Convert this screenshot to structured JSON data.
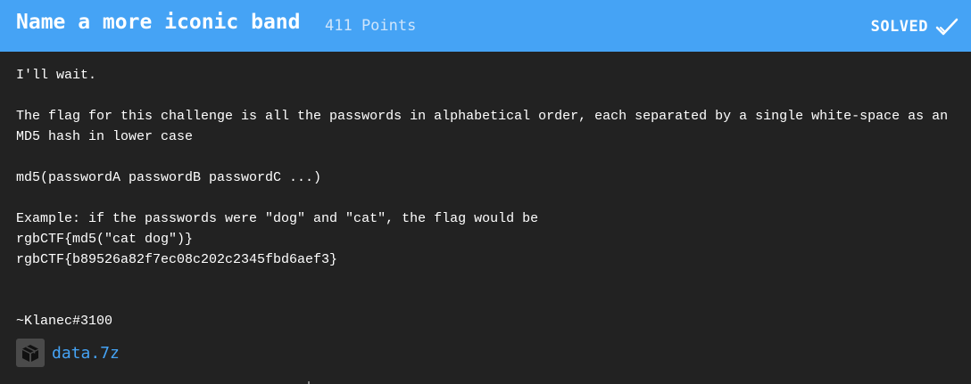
{
  "challenge": {
    "title": "Name a more iconic band",
    "points": "411 Points",
    "status": "SOLVED",
    "status_icon": "check-icon",
    "header_color": "#45a3f5",
    "description": {
      "line1": "I'll wait.",
      "line2": "The flag for this challenge is all the passwords in alphabetical order, each separated by a single white-space as an MD5 hash in lower case",
      "line3": "md5(passwordA passwordB passwordC ...)",
      "line4": "Example: if the passwords were \"dog\" and \"cat\", the flag would be",
      "line5": "rgbCTF{md5(\"cat dog\")}",
      "line6": "rgbCTF{b89526a82f7ec08c202c2345fbd6aef3}",
      "line7": "~Klanec#3100"
    },
    "attachment": {
      "icon": "archive-box-icon",
      "filename": "data.7z",
      "link_color": "#45a3f5"
    }
  }
}
